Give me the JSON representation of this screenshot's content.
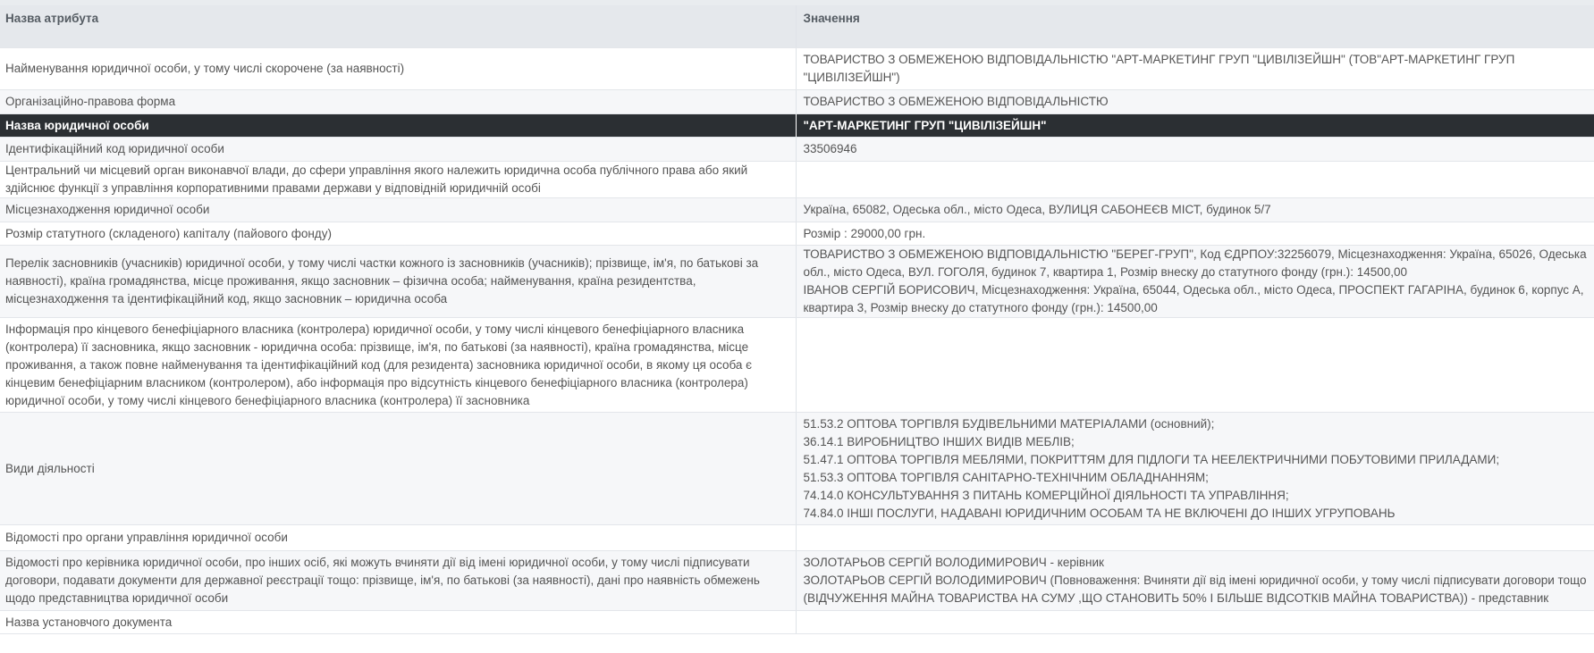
{
  "header": {
    "attribute_col": "Назва атрибута",
    "value_col": "Значення"
  },
  "rows": [
    {
      "attribute": "Найменування юридичної особи, у тому числі скорочене (за наявності)",
      "value": "ТОВАРИСТВО З ОБМЕЖЕНОЮ ВІДПОВІДАЛЬНІСТЮ \"АРТ-МАРКЕТИНГ ГРУП \"ЦИВІЛІЗЕЙШН\" (ТОВ\"АРТ-МАРКЕТИНГ ГРУП \"ЦИВІЛІЗЕЙШН\")"
    },
    {
      "attribute": "Організаційно-правова форма",
      "value": "ТОВАРИСТВО З ОБМЕЖЕНОЮ ВІДПОВІДАЛЬНІСТЮ"
    },
    {
      "attribute": "Назва юридичної особи",
      "value": "\"АРТ-МАРКЕТИНГ ГРУП \"ЦИВІЛІЗЕЙШН\""
    },
    {
      "attribute": "Ідентифікаційний код юридичної особи",
      "value": "33506946"
    },
    {
      "attribute": "Центральний чи місцевий орган виконавчої влади, до сфери управління якого належить юридична особа публічного права або який здійснює функції з управління корпоративними правами держави у відповідній юридичній особі",
      "value": ""
    },
    {
      "attribute": "Місцезнаходження юридичної особи",
      "value": "Україна, 65082, Одеська обл., місто Одеса, ВУЛИЦЯ САБОНЕЄВ МІСТ, будинок 5/7"
    },
    {
      "attribute": "Розмір статутного (складеного) капіталу (пайового фонду)",
      "value": "Розмір : 29000,00 грн."
    },
    {
      "attribute": "Перелік засновників (учасників) юридичної особи, у тому числі частки кожного із засновників (учасників); прізвище, ім'я, по батькові за наявності), країна громадянства, місце проживання, якщо засновник – фізична особа; найменування, країна резидентства, місцезнаходження та ідентифікаційний код, якщо засновник – юридична особа",
      "value_lines": [
        "ТОВАРИСТВО З ОБМЕЖЕНОЮ ВІДПОВІДАЛЬНІСТЮ \"БЕРЕГ-ГРУП\", Код ЄДРПОУ:32256079, Місцезнаходження: Україна, 65026, Одеська обл., місто Одеса, ВУЛ. ГОГОЛЯ, будинок 7, квартира 1, Розмір внеску до статутного фонду (грн.): 14500,00",
        "ІВАНОВ СЕРГІЙ БОРИСОВИЧ, Місцезнаходження: Україна, 65044, Одеська обл., місто Одеса, ПРОСПЕКТ ГАГАРІНА, будинок 6, корпус А, квартира 3, Розмір внеску до статутного фонду (грн.): 14500,00"
      ]
    },
    {
      "attribute": "Інформація про кінцевого бенефіціарного власника (контролера) юридичної особи, у тому числі кінцевого бенефіціарного власника (контролера) її засновника, якщо засновник - юридична особа: прізвище, ім'я, по батькові (за наявності), країна громадянства, місце проживання, а також повне найменування та ідентифікаційний код (для резидента) засновника юридичної особи, в якому ця особа є кінцевим бенефіціарним власником (контролером), або інформація про відсутність кінцевого бенефіціарного власника (контролера) юридичної особи, у тому числі кінцевого бенефіціарного власника (контролера) її засновника",
      "value": ""
    },
    {
      "attribute": "Види діяльності",
      "value_lines": [
        "51.53.2 ОПТОВА ТОРГІВЛЯ БУДІВЕЛЬНИМИ МАТЕРІАЛАМИ (основний);",
        "36.14.1 ВИРОБНИЦТВО ІНШИХ ВИДІВ МЕБЛІВ;",
        "51.47.1 ОПТОВА ТОРГІВЛЯ МЕБЛЯМИ, ПОКРИТТЯМ ДЛЯ ПІДЛОГИ ТА НЕЕЛЕКТРИЧНИМИ ПОБУТОВИМИ ПРИЛАДАМИ;",
        "51.53.3 ОПТОВА ТОРГІВЛЯ САНІТАРНО-ТЕХНІЧНИМ ОБЛАДНАННЯМ;",
        "74.14.0 КОНСУЛЬТУВАННЯ З ПИТАНЬ КОМЕРЦІЙНОЇ ДІЯЛЬНОСТІ ТА УПРАВЛІННЯ;",
        "74.84.0 ІНШІ ПОСЛУГИ, НАДАВАНІ ЮРИДИЧНИМ ОСОБАМ ТА НЕ ВКЛЮЧЕНІ ДО ІНШИХ УГРУПОВАНЬ"
      ]
    },
    {
      "attribute": "Відомості про органи управління юридичної особи",
      "value": ""
    },
    {
      "attribute": "Відомості про керівника юридичної особи, про інших осіб, які можуть вчиняти дії від імені юридичної особи, у тому числі підписувати договори, подавати документи для державної реєстрації тощо: прізвище, ім'я, по батькові (за наявності), дані про наявність обмежень щодо представництва юридичної особи",
      "value_lines": [
        "ЗОЛОТАРЬОВ СЕРГІЙ ВОЛОДИМИРОВИЧ - керівник",
        "ЗОЛОТАРЬОВ СЕРГІЙ ВОЛОДИМИРОВИЧ (Повноваження: Вчиняти дії від імені юридичної особи, у тому числі підписувати договори тощо (ВІДЧУЖЕННЯ МАЙНА ТОВАРИСТВА НА СУМУ ,ЩО СТАНОВИТЬ 50% І БІЛЬШЕ ВІДСОТКІВ МАЙНА ТОВАРИСТВА)) - представник"
      ]
    },
    {
      "attribute": "Назва установчого документа",
      "value": ""
    }
  ]
}
